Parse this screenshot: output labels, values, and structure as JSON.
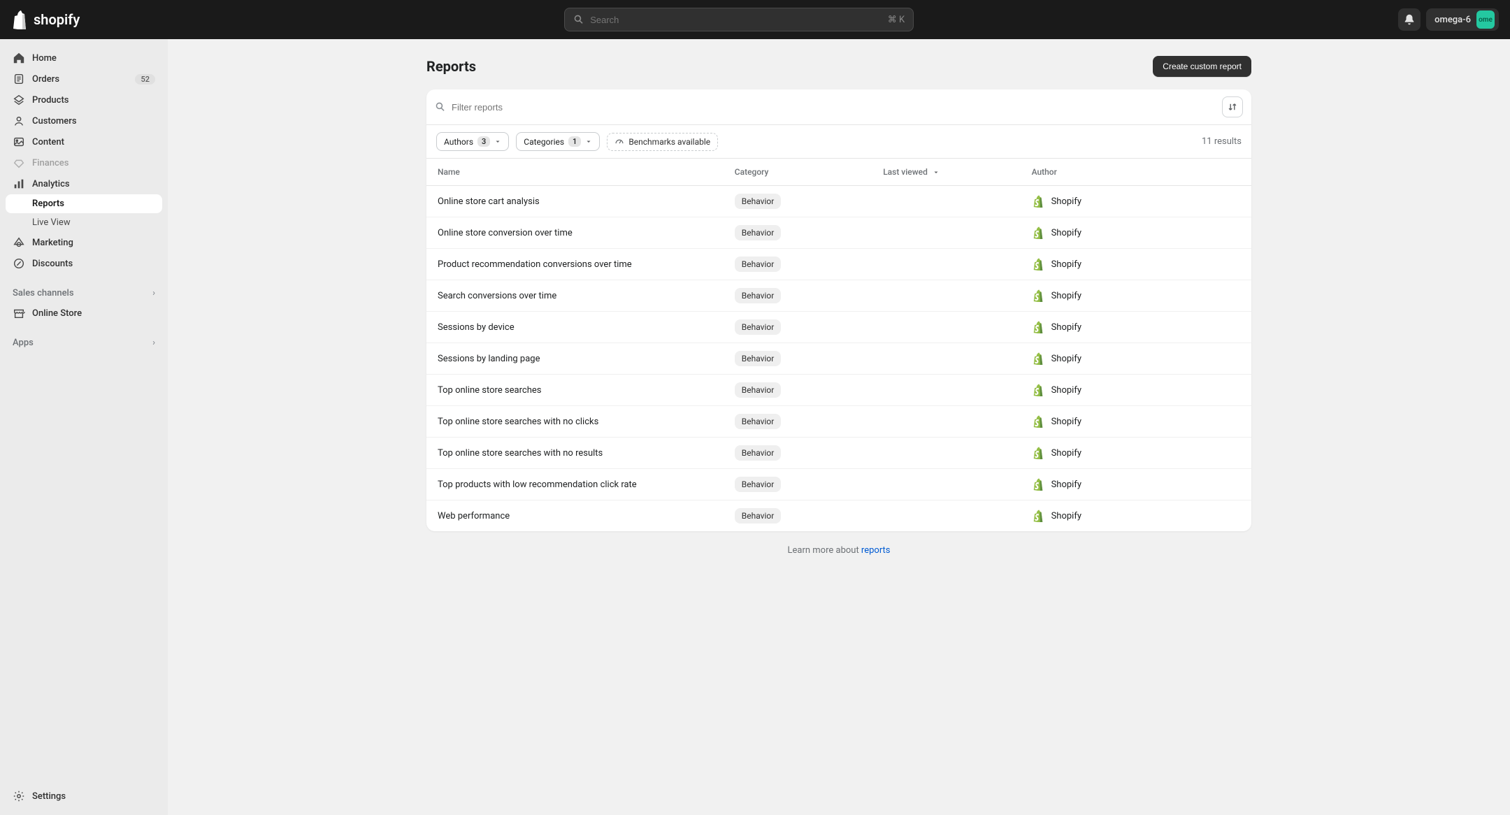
{
  "header": {
    "logo_text": "shopify",
    "search_placeholder": "Search",
    "shortcut": "⌘ K",
    "store_name": "omega-6",
    "avatar_text": "ome"
  },
  "sidebar": {
    "items": [
      {
        "label": "Home"
      },
      {
        "label": "Orders",
        "badge": "52"
      },
      {
        "label": "Products"
      },
      {
        "label": "Customers"
      },
      {
        "label": "Content"
      },
      {
        "label": "Finances"
      },
      {
        "label": "Analytics"
      },
      {
        "label": "Marketing"
      },
      {
        "label": "Discounts"
      }
    ],
    "analytics_sub": [
      {
        "label": "Reports"
      },
      {
        "label": "Live View"
      }
    ],
    "sales_channels_label": "Sales channels",
    "online_store_label": "Online Store",
    "apps_label": "Apps",
    "settings_label": "Settings"
  },
  "page": {
    "title": "Reports",
    "create_button": "Create custom report",
    "filter_placeholder": "Filter reports",
    "authors_filter_label": "Authors",
    "authors_filter_count": "3",
    "categories_filter_label": "Categories",
    "categories_filter_count": "1",
    "benchmarks_label": "Benchmarks available",
    "results_count": "11 results",
    "columns": {
      "name": "Name",
      "category": "Category",
      "last_viewed": "Last viewed",
      "author": "Author"
    },
    "rows": [
      {
        "name": "Online store cart analysis",
        "category": "Behavior",
        "author": "Shopify"
      },
      {
        "name": "Online store conversion over time",
        "category": "Behavior",
        "author": "Shopify"
      },
      {
        "name": "Product recommendation conversions over time",
        "category": "Behavior",
        "author": "Shopify"
      },
      {
        "name": "Search conversions over time",
        "category": "Behavior",
        "author": "Shopify"
      },
      {
        "name": "Sessions by device",
        "category": "Behavior",
        "author": "Shopify"
      },
      {
        "name": "Sessions by landing page",
        "category": "Behavior",
        "author": "Shopify"
      },
      {
        "name": "Top online store searches",
        "category": "Behavior",
        "author": "Shopify"
      },
      {
        "name": "Top online store searches with no clicks",
        "category": "Behavior",
        "author": "Shopify"
      },
      {
        "name": "Top online store searches with no results",
        "category": "Behavior",
        "author": "Shopify"
      },
      {
        "name": "Top products with low recommendation click rate",
        "category": "Behavior",
        "author": "Shopify"
      },
      {
        "name": "Web performance",
        "category": "Behavior",
        "author": "Shopify"
      }
    ],
    "footer_prefix": "Learn more about ",
    "footer_link": "reports"
  }
}
